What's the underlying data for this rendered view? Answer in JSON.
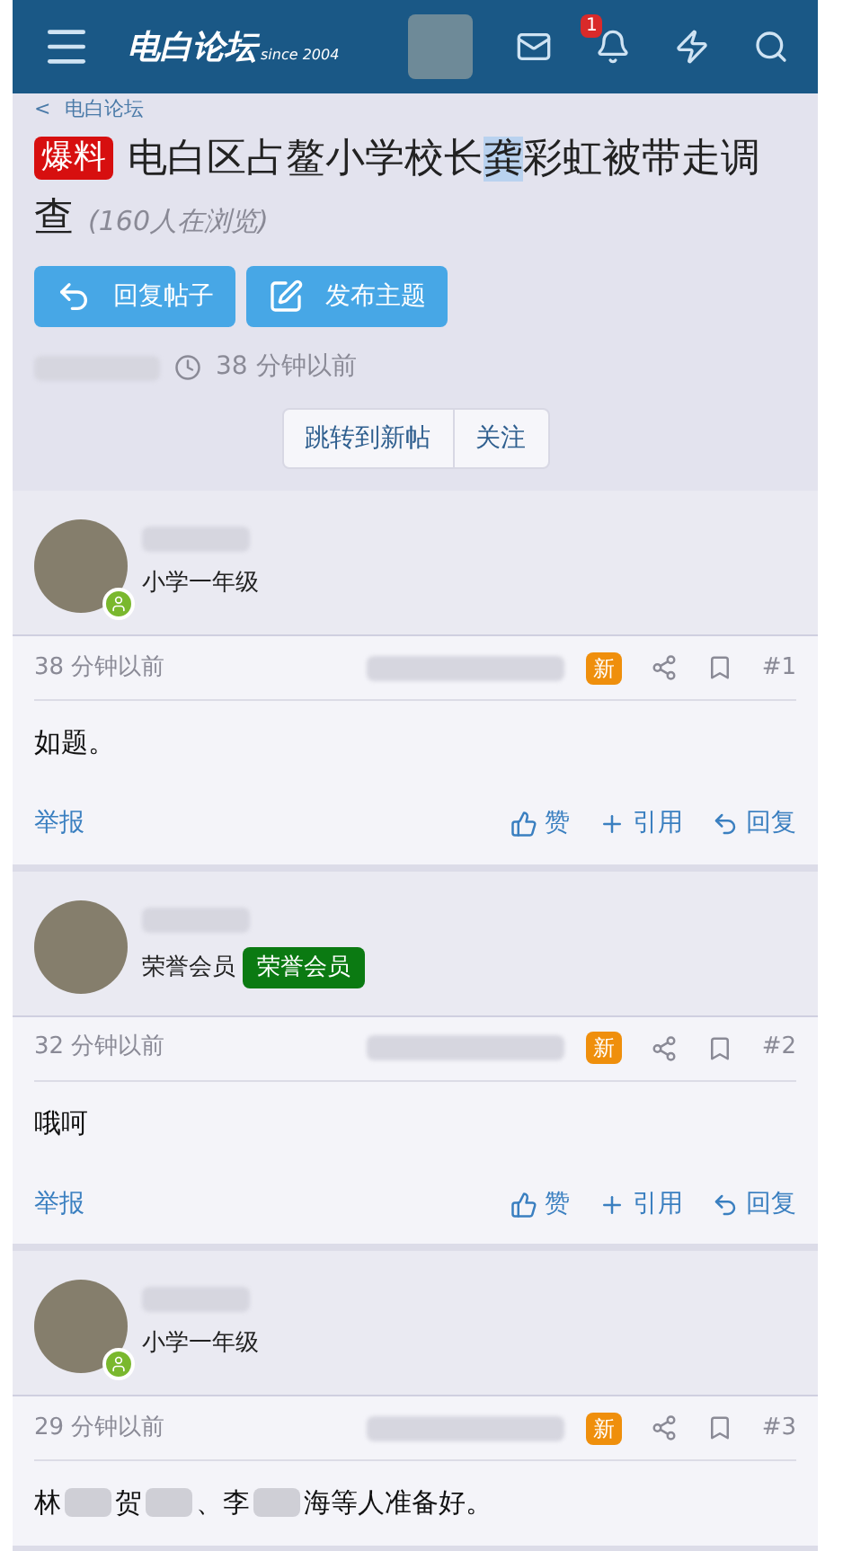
{
  "header": {
    "logo": "电白论坛",
    "logo_sub": "since 2004",
    "notification_count": "1"
  },
  "breadcrumb": {
    "arrow": "<",
    "label": "电白论坛"
  },
  "thread": {
    "prefix": "爆料",
    "title_before": "电白区占鳌小学校长",
    "title_highlight": "龚",
    "title_after": "彩虹被带走调查",
    "viewers": "(160人在浏览)",
    "time": "38 分钟以前"
  },
  "actions": [
    {
      "kind": "reply",
      "label": "回复帖子"
    },
    {
      "kind": "post",
      "label": "发布主题"
    }
  ],
  "nav_buttons": [
    "跳转到新帖",
    "关注"
  ],
  "posts": [
    {
      "user_title": "小学一年级",
      "online": true,
      "time": "38 分钟以前",
      "new_tag": "新",
      "number": "#1",
      "content": [
        {
          "kind": "text",
          "text": "如题。"
        }
      ],
      "report": "举报",
      "like": "赞",
      "quote": "引用",
      "reply": "回复"
    },
    {
      "user_title": "荣誉会员",
      "badge": "荣誉会员",
      "online": false,
      "time": "32 分钟以前",
      "new_tag": "新",
      "number": "#2",
      "content": [
        {
          "kind": "text",
          "text": "哦呵"
        }
      ],
      "report": "举报",
      "like": "赞",
      "quote": "引用",
      "reply": "回复"
    },
    {
      "user_title": "小学一年级",
      "online": true,
      "time": "29 分钟以前",
      "new_tag": "新",
      "number": "#3",
      "content": [
        {
          "kind": "text",
          "text": "林"
        },
        {
          "kind": "redacted"
        },
        {
          "kind": "text",
          "text": "贺"
        },
        {
          "kind": "redacted"
        },
        {
          "kind": "text",
          "text": "、李"
        },
        {
          "kind": "redacted"
        },
        {
          "kind": "text",
          "text": "海等人准备好。"
        }
      ]
    }
  ]
}
